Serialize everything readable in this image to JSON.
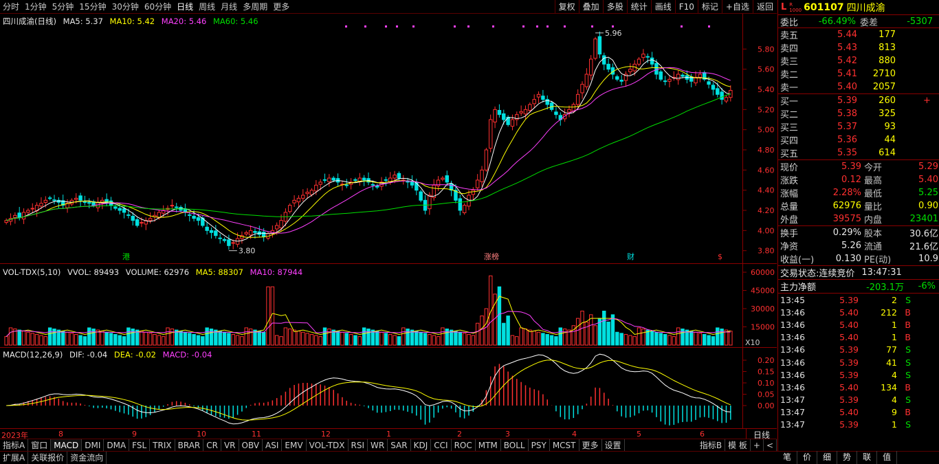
{
  "toolbar": {
    "periods": [
      "分时",
      "1分钟",
      "5分钟",
      "15分钟",
      "30分钟",
      "60分钟",
      "日线",
      "周线",
      "月线",
      "多周期",
      "更多"
    ],
    "tools": [
      "复权",
      "叠加",
      "多股",
      "统计",
      "画线",
      "F10",
      "标记",
      "+自选",
      "返回"
    ]
  },
  "main_pane": {
    "stock_label": "四川成渝(日线)",
    "ma5": "MA5: 5.37",
    "ma10": "MA10: 5.42",
    "ma20": "MA20: 5.46",
    "ma60": "MA60: 5.46",
    "high_mark": "5.96",
    "low_mark": "3.80",
    "y_ticks": [
      "5.80",
      "5.60",
      "5.40",
      "5.20",
      "5.00",
      "4.80",
      "4.60",
      "4.40",
      "4.20",
      "4.00",
      "3.80"
    ],
    "event_tags": [
      "港",
      "涨榜",
      "财",
      "$"
    ]
  },
  "vol_pane": {
    "label": "VOL-TDX(5,10)",
    "vvol": "VVOL: 89493",
    "volume": "VOLUME: 62976",
    "ma5": "MA5: 88307",
    "ma10": "MA10: 87944",
    "y_ticks": [
      "60000",
      "45000",
      "30000",
      "15000"
    ],
    "unit": "X10"
  },
  "macd_pane": {
    "label": "MACD(12,26,9)",
    "dif": "DIF: -0.04",
    "dea": "DEA: -0.02",
    "macd": "MACD: -0.04",
    "y_ticks": [
      "0.20",
      "0.15",
      "0.10",
      "0.05",
      "0.00"
    ]
  },
  "x_axis": {
    "labels": [
      "2023年",
      "8",
      "9",
      "10",
      "11",
      "12",
      "1",
      "2",
      "3",
      "4",
      "5",
      "6"
    ],
    "period": "日线"
  },
  "indicator_tabs": [
    "指标A",
    "窗口",
    "MACD",
    "DMI",
    "DMA",
    "FSL",
    "TRIX",
    "BRAR",
    "CR",
    "VR",
    "OBV",
    "ASI",
    "EMV",
    "VOL-TDX",
    "RSI",
    "WR",
    "SAR",
    "KDJ",
    "CCI",
    "ROC",
    "MTM",
    "BOLL",
    "PSY",
    "MCST",
    "更多",
    "设置"
  ],
  "indicator_right": [
    "指标B",
    "模 板",
    "+",
    "<"
  ],
  "status_tabs": [
    "扩展A",
    "关联报价",
    "资金流向"
  ],
  "quote": {
    "code": "601107",
    "name": "四川成渝",
    "badge_l": "L",
    "badge_r": "R",
    "badge_1000": "1000",
    "weibi_label": "委比",
    "weibi": "-66.49%",
    "weicha_label": "委差",
    "weicha": "-5307",
    "asks": [
      {
        "label": "卖五",
        "price": "5.44",
        "vol": "177"
      },
      {
        "label": "卖四",
        "price": "5.43",
        "vol": "813"
      },
      {
        "label": "卖三",
        "price": "5.42",
        "vol": "880"
      },
      {
        "label": "卖二",
        "price": "5.41",
        "vol": "2710"
      },
      {
        "label": "卖一",
        "price": "5.40",
        "vol": "2057"
      }
    ],
    "bids": [
      {
        "label": "买一",
        "price": "5.39",
        "vol": "260",
        "mark": "+"
      },
      {
        "label": "买二",
        "price": "5.38",
        "vol": "325",
        "mark": ""
      },
      {
        "label": "买三",
        "price": "5.37",
        "vol": "93",
        "mark": ""
      },
      {
        "label": "买四",
        "price": "5.36",
        "vol": "44",
        "mark": ""
      },
      {
        "label": "买五",
        "price": "5.35",
        "vol": "614",
        "mark": ""
      }
    ],
    "stats": [
      {
        "l1": "现价",
        "v1": "5.39",
        "c1": "red",
        "l2": "今开",
        "v2": "5.29",
        "c2": "red"
      },
      {
        "l1": "涨跌",
        "v1": "0.12",
        "c1": "red",
        "l2": "最高",
        "v2": "5.40",
        "c2": "red"
      },
      {
        "l1": "涨幅",
        "v1": "2.28%",
        "c1": "red",
        "l2": "最低",
        "v2": "5.25",
        "c2": "green"
      },
      {
        "l1": "总量",
        "v1": "62976",
        "c1": "yellow",
        "l2": "量比",
        "v2": "0.90",
        "c2": "yellow"
      },
      {
        "l1": "外盘",
        "v1": "39575",
        "c1": "red",
        "l2": "内盘",
        "v2": "23401",
        "c2": "green"
      }
    ],
    "stats2": [
      {
        "l1": "换手",
        "v1": "0.29%",
        "l2": "股本",
        "v2": "30.6亿"
      },
      {
        "l1": "净资",
        "v1": "5.26",
        "l2": "流通",
        "v2": "21.6亿"
      },
      {
        "l1": "收益(一)",
        "v1": "0.130",
        "l2": "PE(动)",
        "v2": "10.9"
      }
    ],
    "trade_status_label": "交易状态:",
    "trade_status": "连续竞价",
    "trade_time": "13:47:31",
    "main_flow_label": "主力净额",
    "main_flow": "-203.1万",
    "main_flow_pct": "-6%"
  },
  "ticks": [
    {
      "t": "13:45",
      "p": "5.39",
      "v": "2",
      "s": "S"
    },
    {
      "t": "13:46",
      "p": "5.40",
      "v": "212",
      "s": "B"
    },
    {
      "t": "13:46",
      "p": "5.40",
      "v": "1",
      "s": "B"
    },
    {
      "t": "13:46",
      "p": "5.40",
      "v": "1",
      "s": "B"
    },
    {
      "t": "13:46",
      "p": "5.39",
      "v": "77",
      "s": "S"
    },
    {
      "t": "13:46",
      "p": "5.39",
      "v": "41",
      "s": "S"
    },
    {
      "t": "13:46",
      "p": "5.39",
      "v": "4",
      "s": "S"
    },
    {
      "t": "13:46",
      "p": "5.40",
      "v": "134",
      "s": "B"
    },
    {
      "t": "13:47",
      "p": "5.39",
      "v": "4",
      "s": "S"
    },
    {
      "t": "13:47",
      "p": "5.40",
      "v": "9",
      "s": "B"
    },
    {
      "t": "13:47",
      "p": "5.39",
      "v": "1",
      "s": "S"
    }
  ],
  "right_tabs": [
    "笔",
    "价",
    "细",
    "势",
    "联",
    "值"
  ],
  "colors": {
    "up": "#ff3030",
    "down": "#00e0e0",
    "ma5": "#ffffff",
    "ma10": "#ffff00",
    "ma20": "#ff40ff",
    "ma60": "#00e000",
    "border": "#8b0000"
  },
  "chart_data": {
    "type": "candlestick",
    "ylim": [
      3.75,
      6.0
    ],
    "price_range_ref": {
      "high": 5.96,
      "low": 3.8
    },
    "closes": [
      4.1,
      4.12,
      4.15,
      4.13,
      4.18,
      4.2,
      4.22,
      4.25,
      4.27,
      4.3,
      4.32,
      4.3,
      4.28,
      4.25,
      4.27,
      4.3,
      4.32,
      4.3,
      4.28,
      4.27,
      4.25,
      4.28,
      4.3,
      4.27,
      4.25,
      4.22,
      4.2,
      4.18,
      4.15,
      4.1,
      4.05,
      4.08,
      4.1,
      4.12,
      4.15,
      4.18,
      4.2,
      4.22,
      4.25,
      4.23,
      4.2,
      4.18,
      4.15,
      4.12,
      4.1,
      4.05,
      4.0,
      3.98,
      3.95,
      3.92,
      3.9,
      3.85,
      3.88,
      3.92,
      3.95,
      3.98,
      4.0,
      3.98,
      3.96,
      3.94,
      3.97,
      4.0,
      4.05,
      4.1,
      4.18,
      4.25,
      4.3,
      4.32,
      4.35,
      4.38,
      4.4,
      4.45,
      4.48,
      4.5,
      4.52,
      4.5,
      4.48,
      4.46,
      4.45,
      4.48,
      4.5,
      4.52,
      4.5,
      4.48,
      4.45,
      4.43,
      4.48,
      4.5,
      4.52,
      4.55,
      4.52,
      4.5,
      4.48,
      4.45,
      4.4,
      4.3,
      4.2,
      4.35,
      4.45,
      4.5,
      4.52,
      4.48,
      4.4,
      4.3,
      4.2,
      4.25,
      4.35,
      4.4,
      4.5,
      4.6,
      4.8,
      5.1,
      5.2,
      5.15,
      5.1,
      5.05,
      5.1,
      5.15,
      5.18,
      5.2,
      5.25,
      5.3,
      5.35,
      5.3,
      5.25,
      5.2,
      5.15,
      5.1,
      5.15,
      5.2,
      5.25,
      5.35,
      5.45,
      5.55,
      5.7,
      5.9,
      5.75,
      5.65,
      5.6,
      5.55,
      5.5,
      5.48,
      5.55,
      5.6,
      5.65,
      5.7,
      5.75,
      5.72,
      5.65,
      5.55,
      5.5,
      5.48,
      5.5,
      5.52,
      5.55,
      5.53,
      5.5,
      5.48,
      5.52,
      5.55,
      5.5,
      5.45,
      5.4,
      5.35,
      5.3,
      5.32,
      5.39
    ]
  }
}
